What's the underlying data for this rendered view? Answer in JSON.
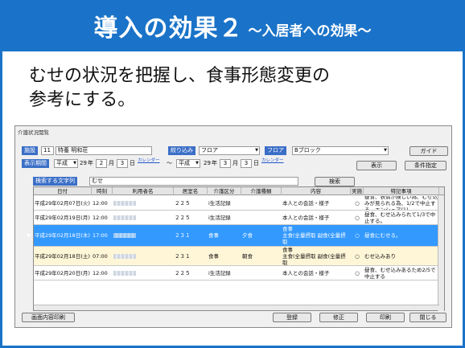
{
  "slide": {
    "title": "導入の効果２",
    "subtitle": "〜入居者への効果〜",
    "body": "むせの状況を把握し、食事形態変更の\n参考にする。"
  },
  "window": {
    "title": "介護状況閲覧",
    "building_label": "施設",
    "building_no": "11",
    "building_name": "特養 明和荘",
    "period_label": "表示期間",
    "era_from": "平成",
    "year_from": "29",
    "year_unit": "年",
    "month_from": "2",
    "month_unit": "月",
    "day_from": "3",
    "day_unit": "日",
    "calendar": "カレンダー",
    "tilde": "〜",
    "era_to": "平成",
    "year_to": "29",
    "month_to": "3",
    "day_to": "3",
    "filter_label": "絞り込み",
    "filter_value": "フロア",
    "floor_label": "フロア",
    "floor_value": "Bブロック",
    "guide_button": "ガイド",
    "display_button": "表示",
    "condition_button": "条件指定",
    "search_label": "検索する文字列",
    "search_value": "むせ",
    "search_button": "検索"
  },
  "grid": {
    "columns": [
      "日付",
      "時刻",
      "利用者名",
      "居室名",
      "介護区分",
      "介護種類",
      "内容",
      "実施",
      "特記事項"
    ],
    "rows": [
      {
        "date": "平成29年02月07日(火)",
        "time": "12:00",
        "room": "２２５",
        "kubun": "i生活記録",
        "shurui": "",
        "naiyo": "本人との会話・様子",
        "jisshi": "○",
        "tokki": "昼食、表情が険しい為、むせ込みが見られる為、1/2で中止する。エンシュア(1)",
        "style": "normal"
      },
      {
        "date": "平成29年02月19日(月)",
        "time": "12:00",
        "room": "２２５",
        "kubun": "i生活記録",
        "shurui": "",
        "naiyo": "本人との会話・様子",
        "jisshi": "○",
        "tokki": "昼食、むせ込みられて1/3で中止する。",
        "style": "normal"
      },
      {
        "date": "平成29年02月18日(木)",
        "time": "17:00",
        "room": "２３１",
        "kubun": "食事",
        "shurui": "夕食",
        "naiyo": "食事\n主食(全量摂取 副食(全量摂取",
        "jisshi": "○",
        "tokki": "昼食にむせる。",
        "style": "sel"
      },
      {
        "date": "平成29年02月18日(土)",
        "time": "07:00",
        "room": "２３１",
        "kubun": "食事",
        "shurui": "朝食",
        "naiyo": "食事\n主食(全量摂取 副食(全量摂取",
        "jisshi": "○",
        "tokki": "むせ込みあり",
        "style": "yellow"
      },
      {
        "date": "平成29年02月20日(月)",
        "time": "12:00",
        "room": "２２５",
        "kubun": "i生活記録",
        "shurui": "",
        "naiyo": "本人との会話・様子",
        "jisshi": "○",
        "tokki": "昼食、むせ込みあるため2/5で中止する",
        "style": "normal"
      }
    ]
  },
  "footer": {
    "print_screen": "画面内容印刷",
    "register": "登録",
    "modify": "修正",
    "print": "印刷",
    "close": "閉じる"
  }
}
